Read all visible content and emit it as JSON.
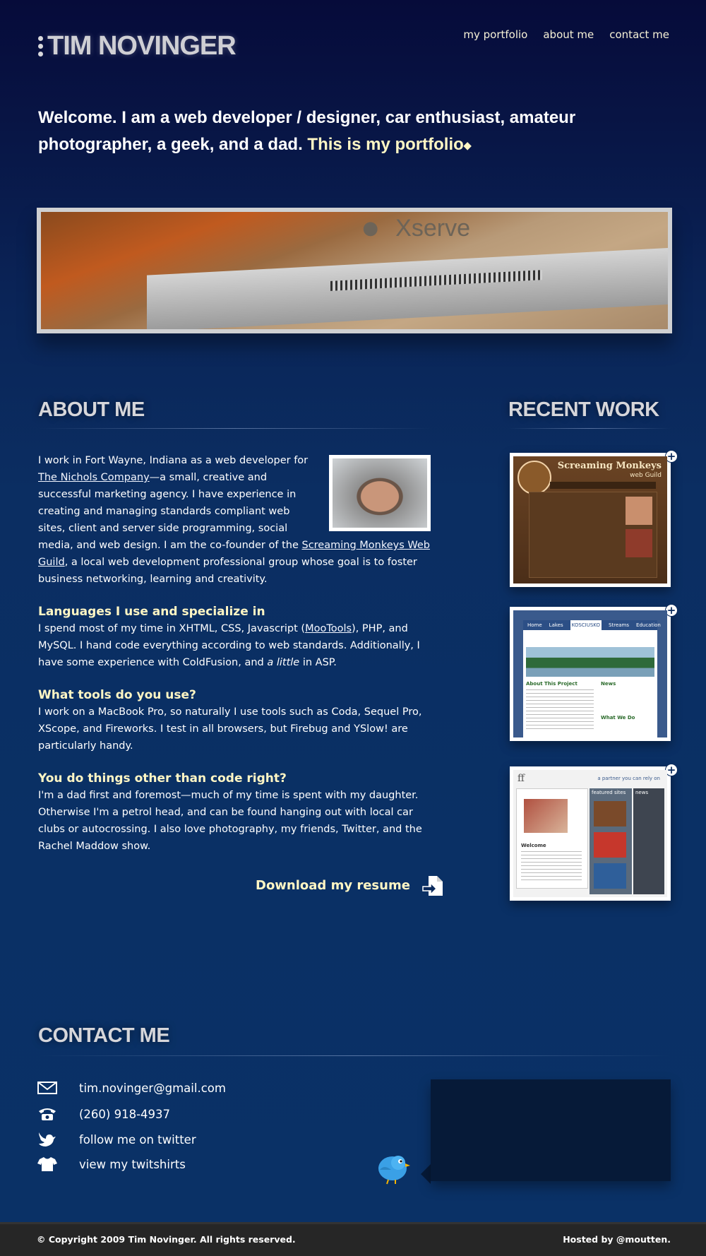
{
  "header": {
    "logo_text": "TIM NOVINGER",
    "nav": [
      "my portfolio",
      "about me",
      "contact me"
    ]
  },
  "welcome": {
    "text": "Welcome. I am a web developer / designer, car enthusiast, amateur photographer, a geek, and a dad.",
    "portfolio_link": "This is my portfolio"
  },
  "hero": {
    "brand": "Xserve"
  },
  "about": {
    "title": "ABOUT ME",
    "intro_1": "I work in Fort Wayne, Indiana as a web developer for ",
    "link_company": "The Nichols Company",
    "intro_2": "—a small, creative and successful marketing agency. I have experience in creating and managing standards compliant web sites, client and server side programming, social media, and web design. I am the co-founder of the ",
    "link_guild": "Screaming Monkeys Web Guild",
    "intro_3": ", a local web development professional group whose goal is to foster business networking, learning and creativity.",
    "h_languages": "Languages I use and specialize in",
    "languages_1": "I spend most of my time in XHTML, CSS, Javascript (",
    "link_mootools": "MooTools",
    "languages_2": "), PHP, and MySQL. I hand code everything according to web standards. Additionally, I have some experience with ColdFusion, and ",
    "languages_em": "a little",
    "languages_3": " in ASP.",
    "h_tools": "What tools do you use?",
    "tools": "I work on a MacBook Pro, so naturally I use tools such as Coda, Sequel Pro, XScope, and Fireworks. I test in all browsers, but Firebug and YSlow! are particularly handy.",
    "h_other": "You do things other than code right?",
    "other": "I'm a dad first and foremost—much of my time is spent with my daughter. Otherwise I'm a petrol head, and can be found hanging out with local car clubs or autocrossing. I also love photography, my friends, Twitter, and the Rachel Maddow show.",
    "resume": "Download my resume"
  },
  "recent_work": {
    "title": "RECENT WORK",
    "items": [
      {
        "site_title": "Screaming Monkeys",
        "site_sub": "web Guild"
      },
      {
        "site_title": "KOSCIUSKO",
        "tabs": [
          "Home",
          "Lakes",
          "Streams",
          "Education"
        ],
        "project": "About This Project",
        "news": "News",
        "what": "What We Do"
      },
      {
        "site_tagline": "a partner you can rely on",
        "featured": "featured sites",
        "welcome": "Welcome",
        "news": "news"
      }
    ]
  },
  "contact": {
    "title": "CONTACT ME",
    "email": "tim.novinger@gmail.com",
    "phone": "(260) 918-4937",
    "twitter": "follow me on twitter",
    "shirts": "view my twitshirts"
  },
  "footer": {
    "copyright": "© Copyright 2009 Tim Novinger. All rights reserved.",
    "hosted": "Hosted by @moutten."
  },
  "colors": {
    "accent": "#fff6c4",
    "background_top": "#060b3a",
    "background_bottom": "#0a3166",
    "footer": "#262626"
  }
}
